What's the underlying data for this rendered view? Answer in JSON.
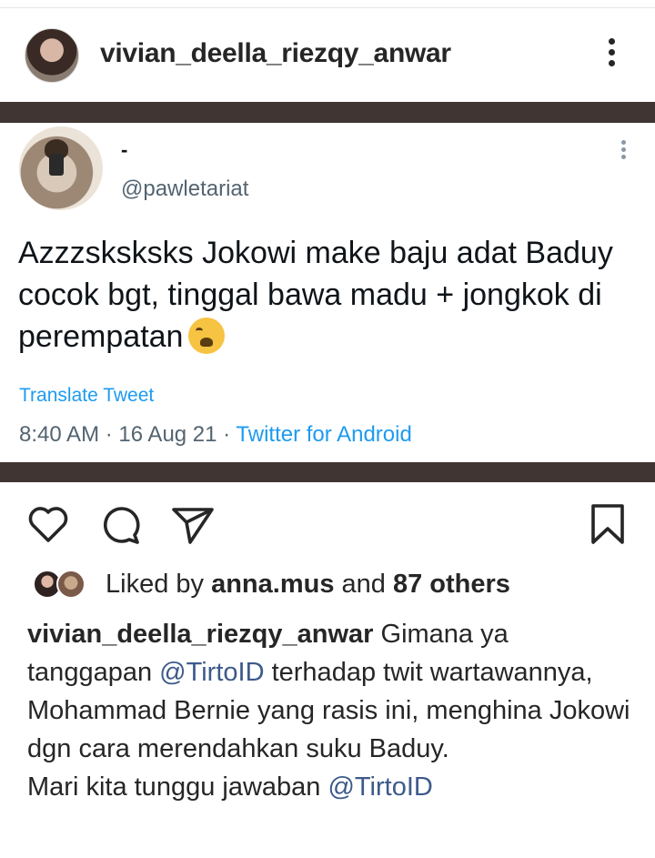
{
  "post": {
    "username": "vivian_deella_riezqy_anwar"
  },
  "tweet": {
    "display_name": "-",
    "handle": "@pawletariat",
    "text": "Azzzsksksks Jokowi make baju adat Baduy cocok bgt, tinggal bawa madu + jongkok di perempatan",
    "emoji_icon": "crying-face-emoji",
    "translate_label": "Translate Tweet",
    "time": "8:40 AM",
    "separator1": " · ",
    "date": "16 Aug 21",
    "separator2": " · ",
    "source": "Twitter for Android",
    "link_color": "#1d9bf0",
    "bar_color": "#403533"
  },
  "actions": {
    "like_icon": "heart-icon",
    "comment_icon": "comment-icon",
    "share_icon": "send-icon",
    "save_icon": "bookmark-icon"
  },
  "likes": {
    "prefix": "Liked by ",
    "first_user": "anna.mus",
    "and": " and ",
    "others": "87 others"
  },
  "caption": {
    "username": "vivian_deella_riezqy_anwar",
    "part1": " Gimana ya tanggapan ",
    "mention1": "@TirtoID",
    "part2": " terhadap twit wartawannya,  Mohammad Bernie yang rasis ini, menghina Jokowi dgn cara merendahkan suku Baduy.",
    "part3": "Mari kita  tunggu jawaban ",
    "mention2": "@TirtoID",
    "mention_color": "#3d5a8a"
  }
}
